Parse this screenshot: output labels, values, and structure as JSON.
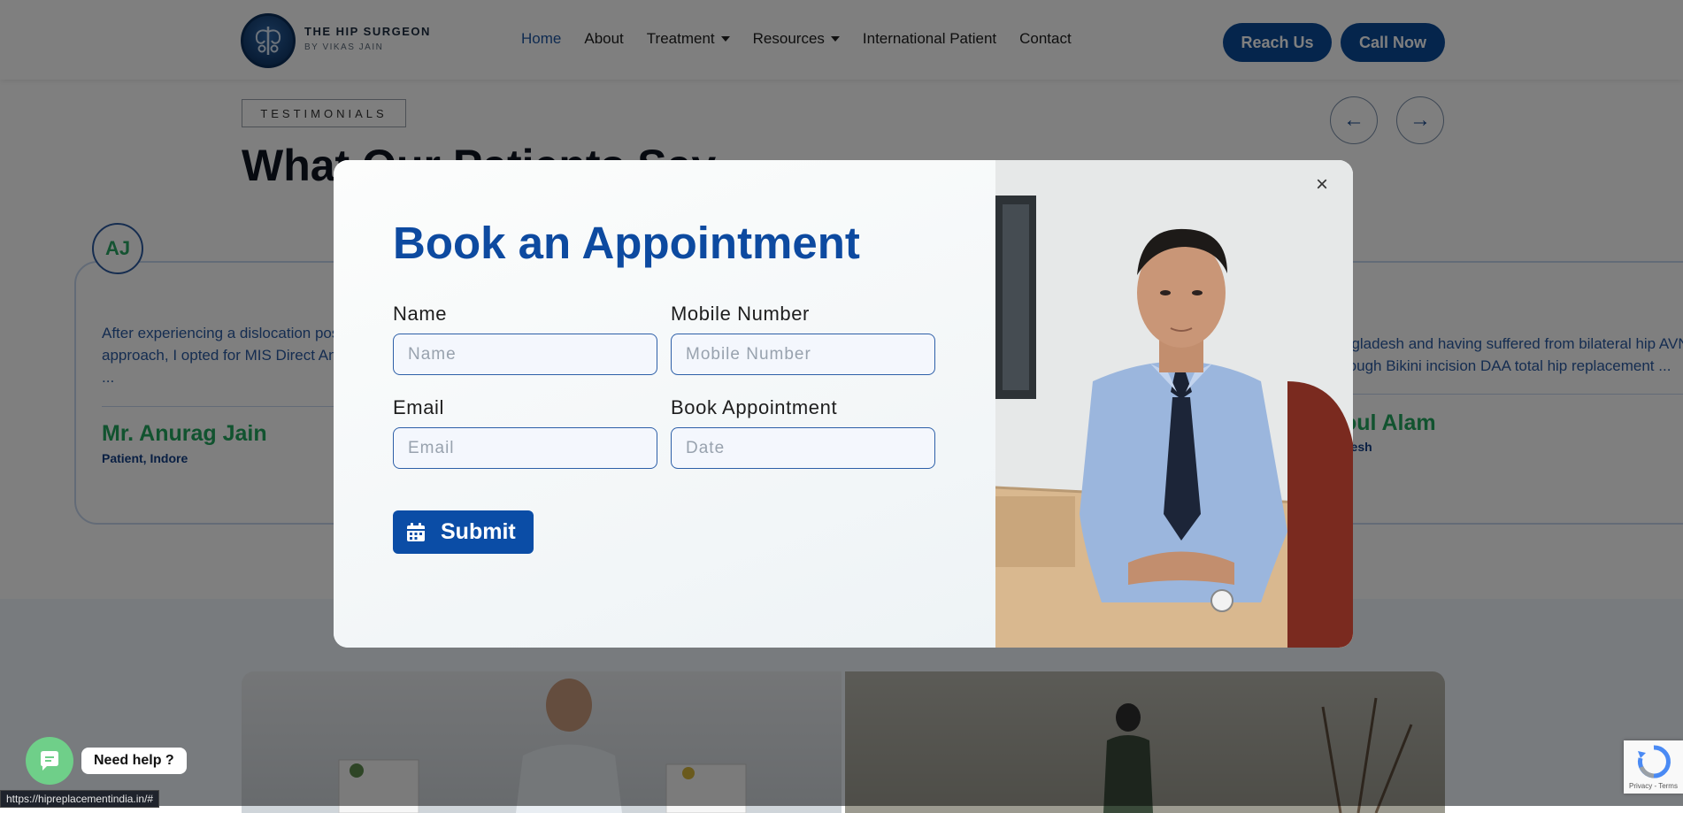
{
  "header": {
    "brand_title": "THE HIP SURGEON",
    "brand_subtitle": "BY VIKAS JAIN",
    "nav": [
      {
        "label": "Home",
        "active": true
      },
      {
        "label": "About"
      },
      {
        "label": "Treatment",
        "dropdown": true
      },
      {
        "label": "Resources",
        "dropdown": true
      },
      {
        "label": "International Patient"
      },
      {
        "label": "Contact"
      }
    ],
    "reach_us": "Reach Us",
    "call_now": "Call Now"
  },
  "testimonials": {
    "tag": "TESTIMONIALS",
    "title": "What Our Patients Say",
    "cards": [
      {
        "initials": "AJ",
        "quote_lines": [
          "After experiencing a dislocation pos",
          "approach, I opted for MIS Direct An",
          "..."
        ],
        "name": "Mr. Anurag Jain",
        "role": "Patient, Indore"
      },
      {
        "quote_lines": [
          "ngladesh and having suffered from bilateral hip AVN",
          "rough Bikini incision DAA total hip replacement ..."
        ],
        "name": "oul Alam",
        "role": "desh"
      }
    ]
  },
  "modal": {
    "title": "Book an Appointment",
    "fields": {
      "name": {
        "label": "Name",
        "placeholder": "Name"
      },
      "mobile": {
        "label": "Mobile Number",
        "placeholder": "Mobile Number"
      },
      "email": {
        "label": "Email",
        "placeholder": "Email"
      },
      "date": {
        "label": "Book Appointment",
        "placeholder": "Date"
      }
    },
    "submit_label": "Submit",
    "close_label": "×"
  },
  "widgets": {
    "help_text": "Need help ?",
    "status_url": "https://hipreplacementindia.in/#",
    "recaptcha_label": "Privacy - Terms"
  },
  "colors": {
    "brand_blue": "#0b4a99",
    "accent_green": "#22a65f",
    "chat_green": "#6fcf89"
  }
}
